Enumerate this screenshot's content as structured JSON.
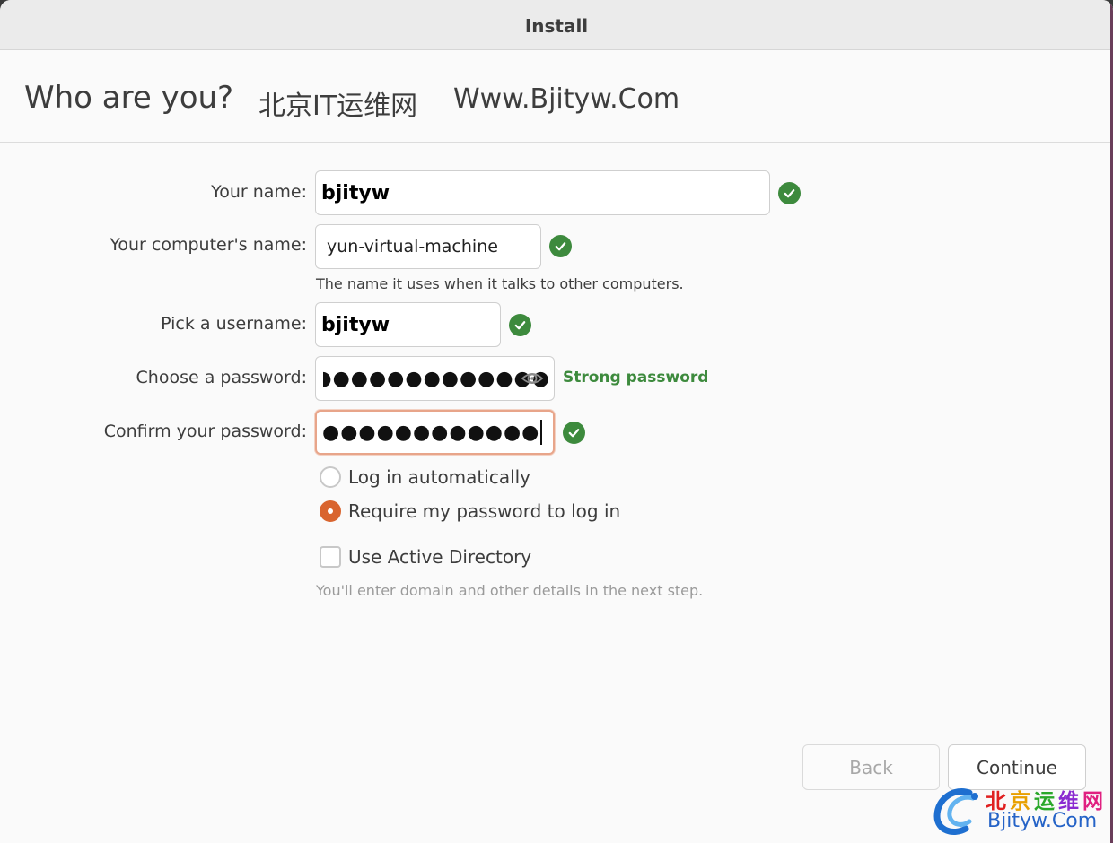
{
  "window": {
    "title": "Install"
  },
  "header": {
    "heading": "Who are you?",
    "watermark_cn": "北京IT运维网",
    "watermark_en": "Www.Bjityw.Com"
  },
  "form": {
    "name_label": "Your name:",
    "name_value": "bjityw",
    "computer_label": "Your computer's name:",
    "computer_value": "yun-virtual-machine",
    "computer_hint": "The name it uses when it talks to other computers.",
    "username_label": "Pick a username:",
    "username_value": "bjityw",
    "password_label": "Choose a password:",
    "password_dots": "◗●●●●●●●●●●●●",
    "password_strength": "Strong password",
    "confirm_label": "Confirm your password:",
    "confirm_dots": "●●●●●●●●●●●●"
  },
  "login_options": {
    "auto_label": "Log in automatically",
    "require_label": "Require my password to log in",
    "selected": "require"
  },
  "active_directory": {
    "label": "Use Active Directory",
    "checked": false,
    "hint": "You'll enter domain and other details in the next step."
  },
  "buttons": {
    "back": "Back",
    "continue": "Continue"
  },
  "logo": {
    "cn": "北京运维网",
    "en": "Bjityw.Com"
  },
  "colors": {
    "success": "#3d8a3d",
    "accent": "#d9652f",
    "focus_border": "#e8a58a"
  }
}
